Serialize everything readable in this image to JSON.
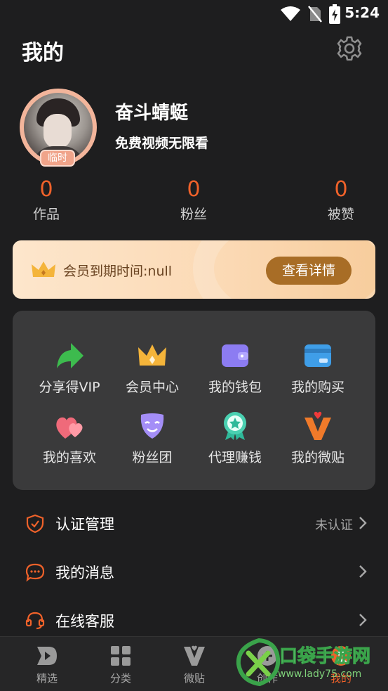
{
  "status": {
    "time": "5:24"
  },
  "header": {
    "title": "我的"
  },
  "profile": {
    "name": "奋斗蜻蜓",
    "tagline": "免费视频无限看",
    "badge": "临时"
  },
  "stats": [
    {
      "value": "0",
      "label": "作品"
    },
    {
      "value": "0",
      "label": "粉丝"
    },
    {
      "value": "0",
      "label": "被赞"
    }
  ],
  "vip": {
    "expiry": "会员到期时间:null",
    "button": "查看详情"
  },
  "grid": [
    {
      "label": "分享得VIP",
      "icon": "share-arrow-icon"
    },
    {
      "label": "会员中心",
      "icon": "crown-icon"
    },
    {
      "label": "我的钱包",
      "icon": "wallet-icon"
    },
    {
      "label": "我的购买",
      "icon": "card-icon"
    },
    {
      "label": "我的喜欢",
      "icon": "hearts-icon"
    },
    {
      "label": "粉丝团",
      "icon": "mask-icon"
    },
    {
      "label": "代理赚钱",
      "icon": "star-medal-icon"
    },
    {
      "label": "我的微贴",
      "icon": "v-heart-icon"
    }
  ],
  "list": [
    {
      "label": "认证管理",
      "value": "未认证",
      "icon": "shield-check-icon"
    },
    {
      "label": "我的消息",
      "value": "",
      "icon": "chat-bubble-icon"
    },
    {
      "label": "在线客服",
      "value": "",
      "icon": "headset-icon"
    }
  ],
  "tabs": [
    {
      "label": "精选",
      "icon": "play-icon"
    },
    {
      "label": "分类",
      "icon": "grid-icon"
    },
    {
      "label": "微贴",
      "icon": "v-icon"
    },
    {
      "label": "创作",
      "icon": "create-icon"
    },
    {
      "label": "我的",
      "icon": "profile-icon"
    }
  ],
  "watermark": {
    "title": "口袋手游网",
    "url": "www.lady75.com"
  },
  "colors": {
    "accent": "#f0622a",
    "vip_button": "#a86d26",
    "card_bg": "#3a3a3b"
  }
}
